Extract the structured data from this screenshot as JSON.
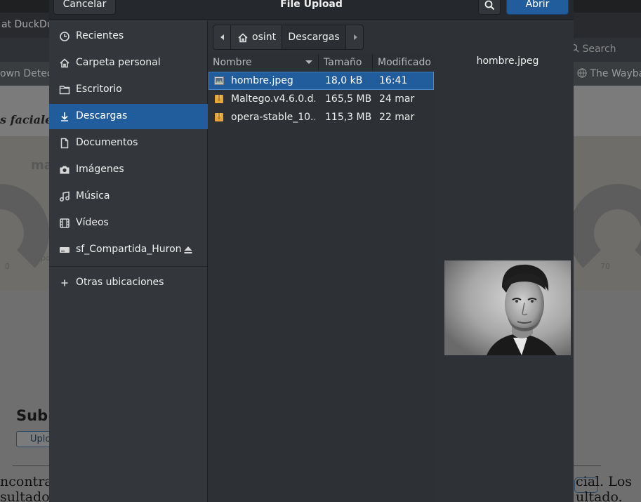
{
  "background": {
    "tab_title": "at DuckDu",
    "bookmark_left": "own Detec",
    "bookmark_right": "The Wayba",
    "search_placeholder": "Search",
    "heading_fragment": "s faciales",
    "gauge_label": "ma",
    "gauge_sub": "po",
    "gauge_min": "0",
    "gauge_max": "70",
    "section_title": "Sub",
    "upload_button": "Uplo",
    "para_left_1": "ncontra",
    "para_left_2": "sultado",
    "para_right_1": "cial. Los",
    "para_right_2": "ultado."
  },
  "dialog": {
    "title": "File Upload",
    "cancel_label": "Cancelar",
    "open_label": "Abrir",
    "accent_color": "#215d9c"
  },
  "sidebar": {
    "items": [
      {
        "label": "Recientes",
        "icon": "clock-icon"
      },
      {
        "label": "Carpeta personal",
        "icon": "home-icon"
      },
      {
        "label": "Escritorio",
        "icon": "folder-icon"
      },
      {
        "label": "Descargas",
        "icon": "download-icon",
        "active": true
      },
      {
        "label": "Documentos",
        "icon": "document-icon"
      },
      {
        "label": "Imágenes",
        "icon": "camera-icon"
      },
      {
        "label": "Música",
        "icon": "music-icon"
      },
      {
        "label": "Vídeos",
        "icon": "film-icon"
      },
      {
        "label": "sf_Compartida_Huron",
        "icon": "drive-icon"
      }
    ],
    "other_locations": "Otras ubicaciones"
  },
  "pathbar": {
    "home_label": "osint",
    "current_label": "Descargas"
  },
  "filelist": {
    "columns": [
      "Nombre",
      "Tamaño",
      "Modificado"
    ],
    "rows": [
      {
        "name": "hombre.jpeg",
        "size": "18,0 kB",
        "modified": "16:41",
        "selected": true,
        "icon": "image-file-icon"
      },
      {
        "name": "Maltego.v4.6.0.d...",
        "size": "165,5 MB",
        "modified": "24 mar",
        "icon": "package-file-icon"
      },
      {
        "name": "opera-stable_10...",
        "size": "115,3 MB",
        "modified": "22 mar",
        "icon": "package-file-icon"
      }
    ]
  },
  "preview": {
    "filename": "hombre.jpeg"
  }
}
